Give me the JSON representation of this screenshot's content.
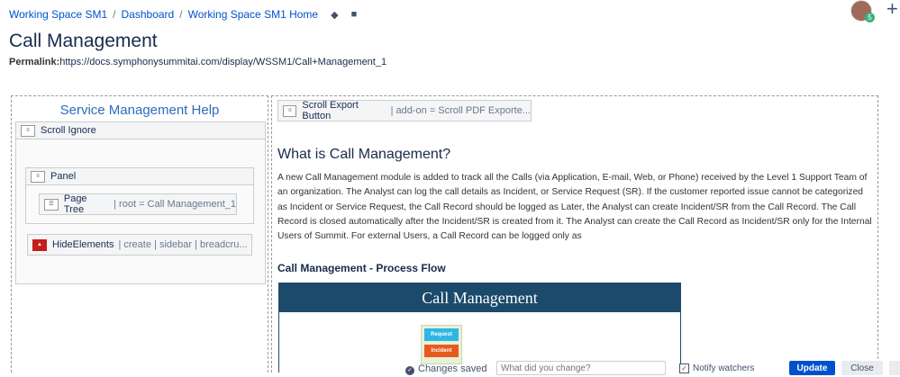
{
  "breadcrumbs": [
    "Working Space SM1",
    "Dashboard",
    "Working Space SM1 Home"
  ],
  "breadcrumb_separator": "/",
  "header": {
    "title": "Call Management",
    "permalink_label": "Permalink:",
    "permalink_url": "https://docs.symphonysummitai.com/display/WSSM1/Call+Management_1",
    "avatar_badge": "5"
  },
  "sidebar": {
    "heading": "Service Management Help",
    "macros": {
      "scroll_ignore": {
        "name": "Scroll Ignore"
      },
      "panel": {
        "name": "Panel"
      },
      "page_tree": {
        "name": "Page Tree",
        "param": "| root = Call Management_1"
      },
      "hide_elements": {
        "name": "HideElements",
        "param": "| create | sidebar | breadcru..."
      }
    }
  },
  "content": {
    "export_macro": {
      "name": "Scroll Export Button",
      "param": "| add-on = Scroll PDF Exporte..."
    },
    "heading": "What is Call Management?",
    "paragraph": "A new Call Management module is added to track all the Calls (via Application, E-mail, Web, or Phone) received by the Level 1 Support Team of an organization. The Analyst can log the call details as Incident, or Service Request (SR). If the customer reported issue cannot be categorized as Incident or Service Request, the Call Record should be logged as Later, the Analyst can create Incident/SR from the Call Record. The Call Record is closed automatically after the Incident/SR is created from it. The Analyst can create the Call Record as Incident/SR only for the Internal Users of Summit. For external Users, a Call Record can be logged only as",
    "flow_heading": "Call Management - Process Flow",
    "diagram": {
      "title": "Call Management",
      "request": "Request",
      "incident": "Incident"
    }
  },
  "footer": {
    "status": "Changes saved",
    "change_placeholder": "What did you change?",
    "notify": "Notify watchers",
    "update": "Update",
    "close": "Close"
  },
  "colors": {
    "link": "#0052cc",
    "primary_button": "#0052cc",
    "diagram_header": "#1c4a6b"
  }
}
